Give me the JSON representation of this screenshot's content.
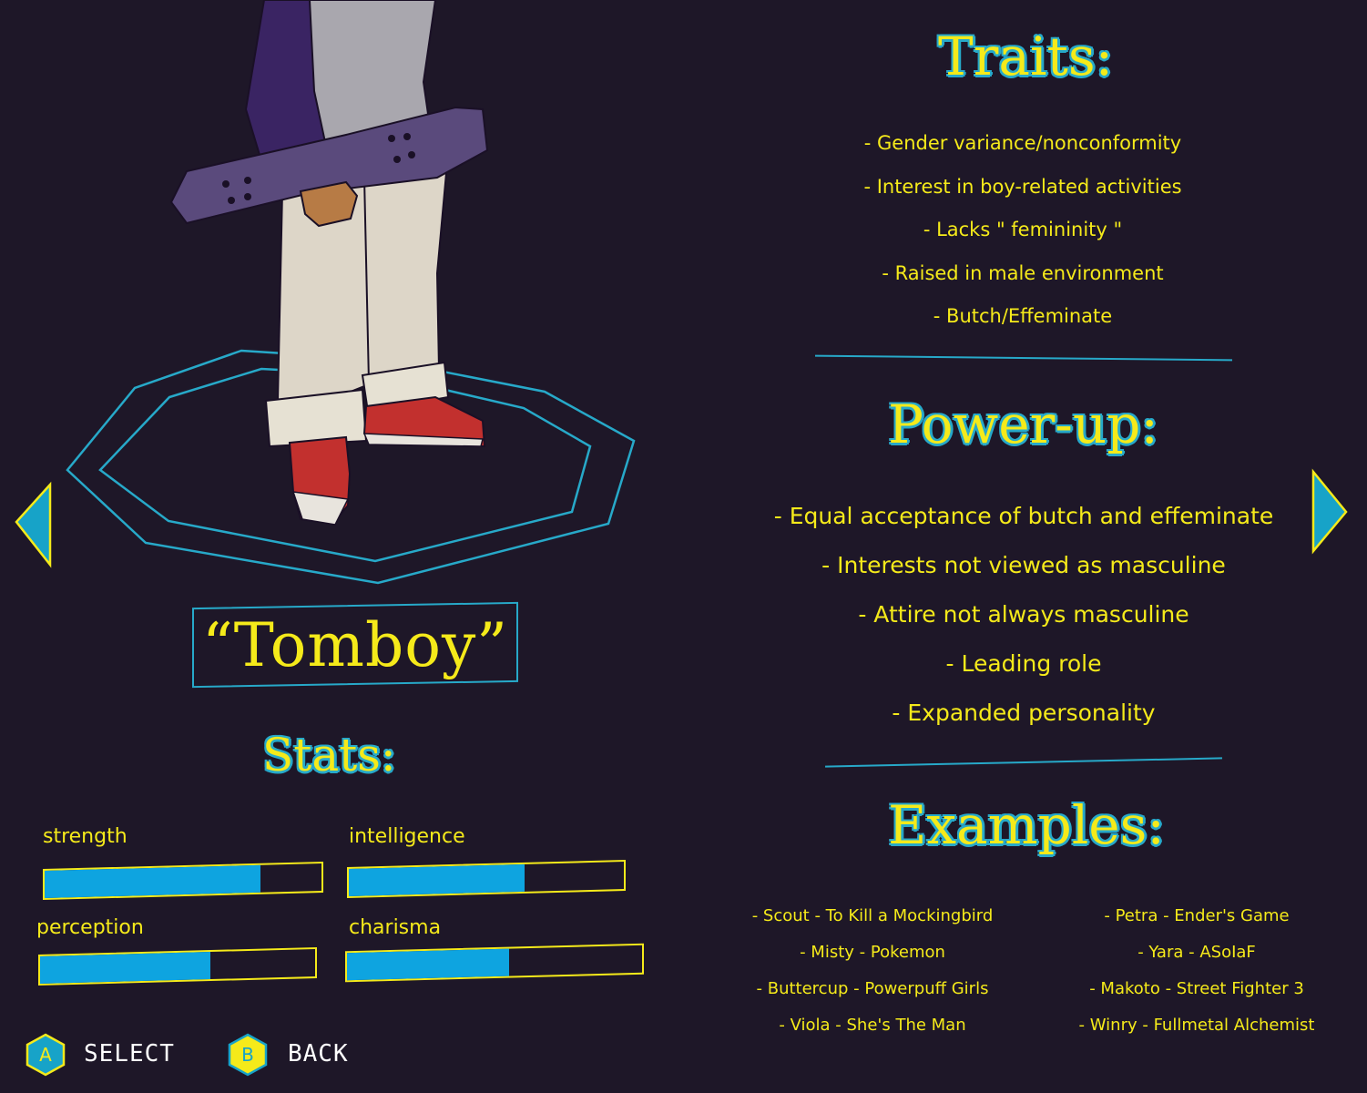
{
  "character": {
    "name": "“Tomboy”"
  },
  "stats": {
    "heading": "Stats:",
    "items": [
      {
        "label": "strength",
        "value": 0.78
      },
      {
        "label": "intelligence",
        "value": 0.64
      },
      {
        "label": "perception",
        "value": 0.62
      },
      {
        "label": "charisma",
        "value": 0.55
      }
    ]
  },
  "traits": {
    "heading": "Traits:",
    "items": [
      "- Gender variance/nonconformity",
      "- Interest in boy-related activities",
      "- Lacks \" femininity \"",
      "- Raised in male environment",
      "- Butch/Effeminate"
    ]
  },
  "powerup": {
    "heading": "Power-up:",
    "items": [
      "- Equal acceptance of butch and effeminate",
      "- Interests not viewed as masculine",
      "- Attire not always masculine",
      "- Leading role",
      "- Expanded personality"
    ]
  },
  "examples": {
    "heading": "Examples:",
    "left": [
      "- Scout - To Kill a Mockingbird",
      "- Misty - Pokemon",
      "- Buttercup - Powerpuff Girls",
      "- Viola - She's The Man"
    ],
    "right": [
      "- Petra - Ender's Game",
      "- Yara - ASoIaF",
      "- Makoto - Street Fighter 3",
      "- Winry - Fullmetal Alchemist"
    ]
  },
  "controls": {
    "select_key": "A",
    "select_label": "SELECT",
    "back_key": "B",
    "back_label": "BACK"
  },
  "colors": {
    "background": "#1e1728",
    "accent_yellow": "#f5ea1a",
    "accent_cyan": "#27a9c9",
    "bar_fill": "#0ea4e0"
  }
}
